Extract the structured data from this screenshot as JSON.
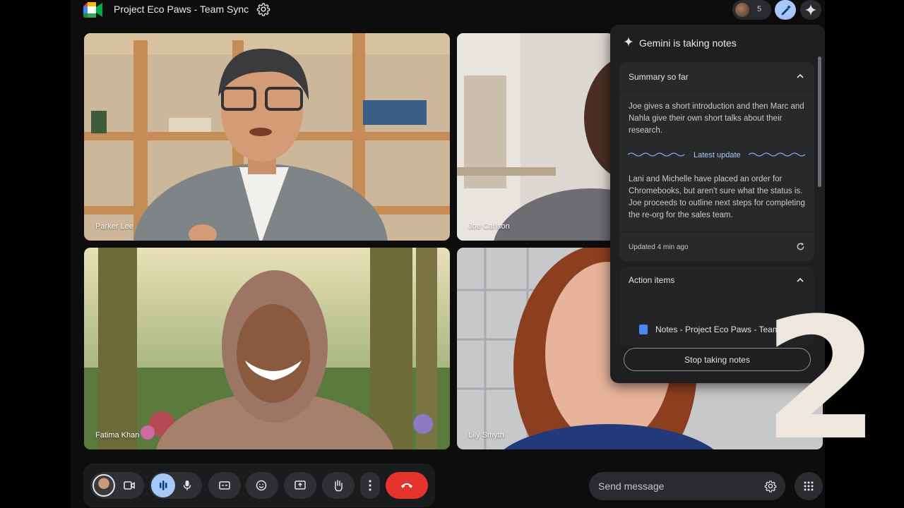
{
  "meeting": {
    "title": "Project Eco Paws - Team Sync",
    "participant_count": "5"
  },
  "participants": [
    {
      "name": "Parker Lee"
    },
    {
      "name": "Joe Carlson"
    },
    {
      "name": "Fatima Khan"
    },
    {
      "name": "Lily Smyth"
    }
  ],
  "notes_panel": {
    "title": "Gemini is taking notes",
    "summary": {
      "heading": "Summary so far",
      "text": "Joe gives a short introduction and then Marc and Nahla give their own short talks about their research.",
      "latest_label": "Latest update",
      "latest_text": "Lani and Michelle have placed an order for Chromebooks, but aren't sure what the status is. Joe proceeds to outline next steps for completing the re-org for the sales team.",
      "updated": "Updated 4 min ago"
    },
    "action_items": {
      "heading": "Action items",
      "doc_label": "Notes - Project Eco Paws - Team..."
    },
    "stop_label": "Stop taking notes"
  },
  "chat": {
    "placeholder": "Send message"
  },
  "overlay": {
    "number": "2"
  },
  "colors": {
    "end_call": "#e3352b",
    "mic_active": "#a8c7fa",
    "panel_bg": "#1f1f21"
  }
}
